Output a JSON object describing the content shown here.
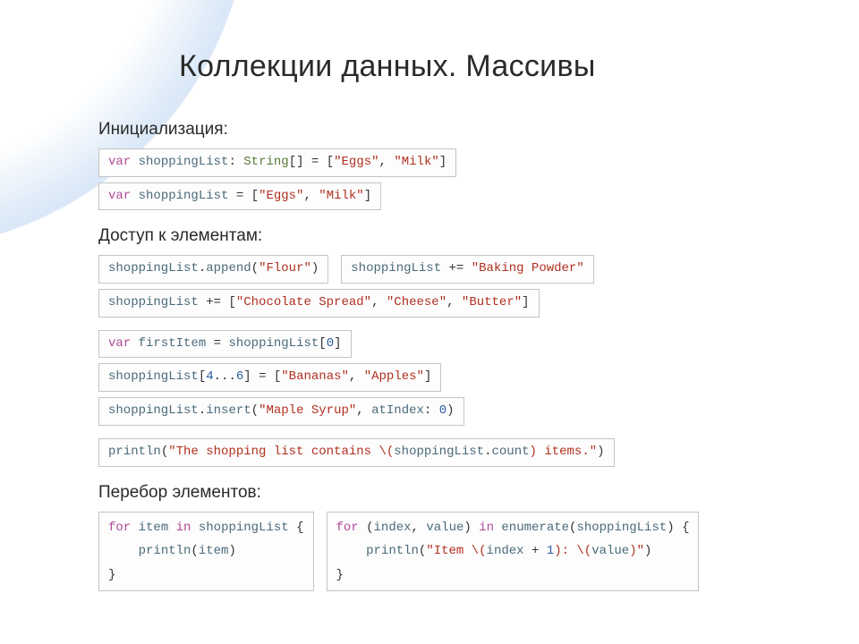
{
  "title": "Коллекции данных. Массивы",
  "sections": {
    "init": "Инициализация:",
    "access": "Доступ к элементам:",
    "loop": "Перебор элементов:"
  },
  "tokens": {
    "var": "var",
    "for": "for",
    "in": "in",
    "String": "String",
    "shoppingList": "shoppingList",
    "firstItem": "firstItem",
    "item": "item",
    "index": "index",
    "value": "value",
    "append": "append",
    "insert": "insert",
    "enumerate": "enumerate",
    "println": "println",
    "count": "count",
    "atIndex": "atIndex"
  },
  "strings": {
    "eggs": "\"Eggs\"",
    "milk": "\"Milk\"",
    "flour": "\"Flour\"",
    "bakingPowder": "\"Baking Powder\"",
    "chocSpread": "\"Chocolate Spread\"",
    "cheese": "\"Cheese\"",
    "butter": "\"Butter\"",
    "bananas": "\"Bananas\"",
    "apples": "\"Apples\"",
    "mapleSyrup": "\"Maple Syrup\"",
    "listContainsA": "\"The shopping list contains \\(",
    "listContainsB": ") items.\"",
    "itemA": "\"Item \\(",
    "itemB": "): \\(",
    "itemC": ")\""
  },
  "nums": {
    "zero": "0",
    "one": "1",
    "four": "4",
    "six": "6"
  },
  "punct": {
    "colonSp": ": ",
    "brOpen": "[] = [",
    "commaSp": ", ",
    "closeBr": "]",
    "eqBr": " = [",
    "dot": ".",
    "lpar": "(",
    "rpar": ")",
    "plusEq": " += ",
    "plusEqBr": " += [",
    "eq": " = ",
    "idx0": "[",
    "range": "...",
    "lbrace": " {",
    "rbrace": "}",
    "plus": " + ",
    "parTuple": " (",
    "rparIn": ") "
  },
  "indent": "    "
}
